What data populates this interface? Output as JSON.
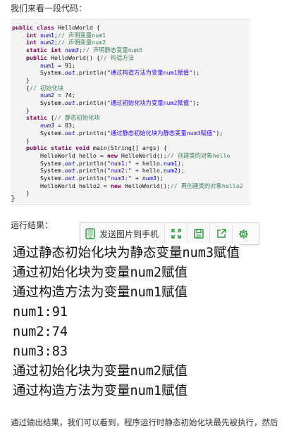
{
  "intro_text": "我们来看一段代码：",
  "code_lines": [
    [
      "public class HelloWorld {"
    ],
    [
      "    int num1;// 声明变量num1"
    ],
    [
      "    int num2;// 声明变量num2"
    ],
    [
      "    static int num3;// 声明静态变量num3"
    ],
    [
      "    public HelloWorld() {// 构造方法"
    ],
    [
      "        num1 = 91;"
    ],
    [
      "        System.out.println(\"通过构造方法为变量num1赋值\");"
    ],
    [
      "    }"
    ],
    [
      "    {// 初始化块"
    ],
    [
      "        num2 = 74;"
    ],
    [
      "        System.out.println(\"通过初始化块为变量num2赋值\");"
    ],
    [
      "    }"
    ],
    [
      "    static {// 静态初始化块"
    ],
    [
      "        num3 = 83;"
    ],
    [
      "        System.out.println(\"通过静态初始化块为静态变量num3赋值\");"
    ],
    [
      "    }"
    ],
    [
      "    public static void main(String[] args) {"
    ],
    [
      "        HelloWorld hello = new HelloWorld();// 创建类的对象hello"
    ],
    [
      "        System.out.println(\"num1:\" + hello.num1);"
    ],
    [
      "        System.out.println(\"num2:\" + hello.num2);"
    ],
    [
      "        System.out.println(\"num3:\" + num3);"
    ],
    [
      "        HelloWorld hello2 = new HelloWorld();// 再创建类的对象hello2"
    ],
    [
      "    }"
    ]
  ],
  "closing_brace": "}",
  "result_label": "运行结果：",
  "toolbar": {
    "send_label": "发送图片到手机",
    "icons": [
      "expand-icon",
      "save-icon",
      "share-icon",
      "settings-icon"
    ],
    "accent_color": "#2a9d3c"
  },
  "output_lines": [
    "通过静态初始化块为静态变量num3赋值",
    "通过初始化块为变量num2赋值",
    "通过构造方法为变量num1赋值",
    "num1:91",
    "num2:74",
    "num3:83",
    "通过初始化块为变量num2赋值",
    "通过构造方法为变量num1赋值"
  ],
  "bottom_text": "通过输出结果，我们可以看到，程序运行时静态初始化块最先被执行，然后"
}
